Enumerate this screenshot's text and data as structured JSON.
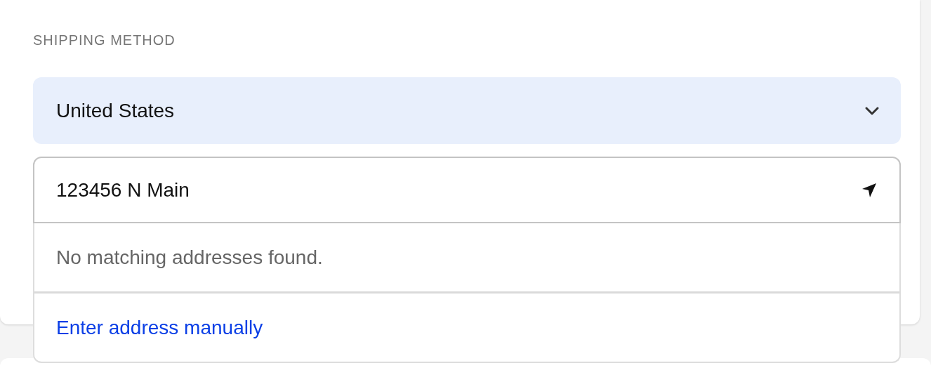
{
  "section_label": "SHIPPING METHOD",
  "country_select": {
    "value": "United States"
  },
  "address_field": {
    "value": "123456 N Main"
  },
  "suggestions": [
    {
      "kind": "message",
      "text": "No matching addresses found."
    },
    {
      "kind": "link",
      "text": "Enter address manually"
    }
  ]
}
